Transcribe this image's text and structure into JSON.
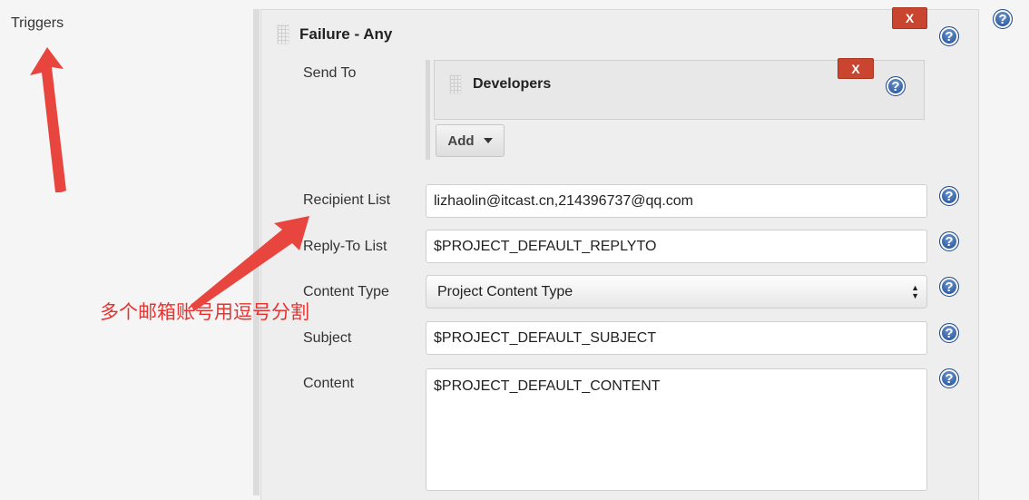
{
  "sidebar": {
    "section_label": "Triggers"
  },
  "trigger": {
    "title": "Failure - Any",
    "delete_label": "X",
    "help_symbol": "?",
    "send_to": {
      "label": "Send To",
      "recipient": {
        "title": "Developers",
        "delete_label": "X"
      },
      "add_button_label": "Add"
    },
    "fields": {
      "recipient_list": {
        "label": "Recipient List",
        "value": "lizhaolin@itcast.cn,214396737@qq.com"
      },
      "reply_to_list": {
        "label": "Reply-To List",
        "value": "$PROJECT_DEFAULT_REPLYTO"
      },
      "content_type": {
        "label": "Content Type",
        "value": "Project Content Type"
      },
      "subject": {
        "label": "Subject",
        "value": "$PROJECT_DEFAULT_SUBJECT"
      },
      "content": {
        "label": "Content",
        "value": "$PROJECT_DEFAULT_CONTENT"
      }
    }
  },
  "annotation": {
    "text": "多个邮箱账号用逗号分割",
    "color": "#e8322f"
  },
  "icons": {
    "help": "question-circle-icon",
    "drag": "drag-handle-icon",
    "arrow": "red-arrow"
  },
  "colors": {
    "delete_button": "#c9452f",
    "help_icon": "#2a5aa4",
    "panel_background": "#eeeeee"
  }
}
